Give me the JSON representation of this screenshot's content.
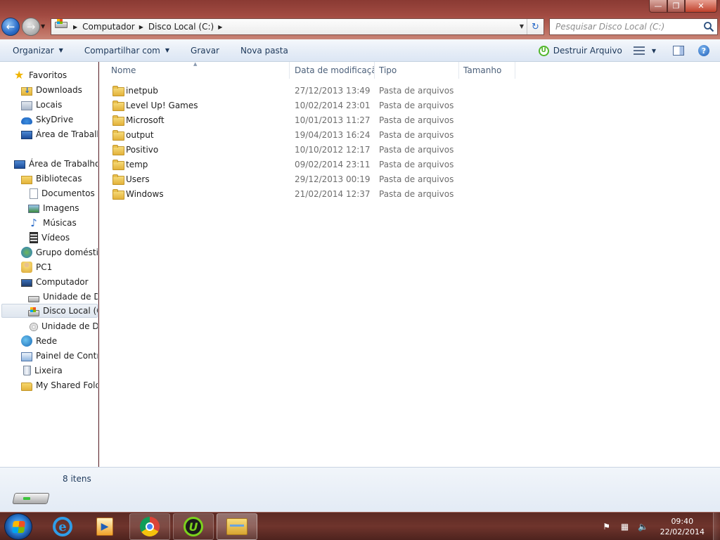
{
  "window": {
    "controls": {
      "minimize": "—",
      "maximize": "❐",
      "close": "✕"
    }
  },
  "address": {
    "crumbs": [
      "Computador",
      "Disco Local (C:)"
    ],
    "search_placeholder": "Pesquisar Disco Local (C:)"
  },
  "toolbar": {
    "organizar": "Organizar",
    "compartilhar": "Compartilhar com",
    "gravar": "Gravar",
    "nova_pasta": "Nova pasta",
    "destruir": "Destruir Arquivo"
  },
  "navpane": {
    "items": [
      {
        "label": "Favoritos",
        "icon": "star-icon"
      },
      {
        "label": "Downloads",
        "icon": "downloads-folder-icon"
      },
      {
        "label": "Locais",
        "icon": "recent-places-icon"
      },
      {
        "label": "SkyDrive",
        "icon": "skydrive-icon"
      },
      {
        "label": "Área de Trabalho",
        "icon": "desktop-icon"
      },
      {
        "label": "Área de Trabalho",
        "icon": "desktop-icon"
      },
      {
        "label": "Bibliotecas",
        "icon": "libraries-icon"
      },
      {
        "label": "Documentos",
        "icon": "documents-icon"
      },
      {
        "label": "Imagens",
        "icon": "pictures-icon"
      },
      {
        "label": "Músicas",
        "icon": "music-icon"
      },
      {
        "label": "Vídeos",
        "icon": "videos-icon"
      },
      {
        "label": "Grupo doméstico",
        "icon": "homegroup-icon"
      },
      {
        "label": "PC1",
        "icon": "user-folder-icon"
      },
      {
        "label": "Computador",
        "icon": "computer-icon"
      },
      {
        "label": "Unidade de Disquete",
        "icon": "drive-icon"
      },
      {
        "label": "Disco Local (C:)",
        "icon": "local-disk-icon"
      },
      {
        "label": "Unidade de DVD",
        "icon": "dvd-drive-icon"
      },
      {
        "label": "Rede",
        "icon": "network-icon"
      },
      {
        "label": "Painel de Controle",
        "icon": "control-panel-icon"
      },
      {
        "label": "Lixeira",
        "icon": "recycle-bin-icon"
      },
      {
        "label": "My Shared Folder",
        "icon": "shared-folder-icon"
      }
    ]
  },
  "columns": [
    "Nome",
    "Data de modificação",
    "Tipo",
    "Tamanho"
  ],
  "files": [
    {
      "name": "inetpub",
      "date": "27/12/2013 13:49",
      "type": "Pasta de arquivos"
    },
    {
      "name": "Level Up! Games",
      "date": "10/02/2014 23:01",
      "type": "Pasta de arquivos"
    },
    {
      "name": "Microsoft",
      "date": "10/01/2013 11:27",
      "type": "Pasta de arquivos"
    },
    {
      "name": "output",
      "date": "19/04/2013 16:24",
      "type": "Pasta de arquivos"
    },
    {
      "name": "Positivo",
      "date": "10/10/2012 12:17",
      "type": "Pasta de arquivos"
    },
    {
      "name": "temp",
      "date": "09/02/2014 23:11",
      "type": "Pasta de arquivos"
    },
    {
      "name": "Users",
      "date": "29/12/2013 00:19",
      "type": "Pasta de arquivos"
    },
    {
      "name": "Windows",
      "date": "21/02/2014 12:37",
      "type": "Pasta de arquivos"
    }
  ],
  "details": {
    "count": "8 itens"
  },
  "taskbar": {
    "time": "09:40",
    "date": "22/02/2014",
    "apps": [
      "internet-explorer-icon",
      "windows-media-player-icon",
      "chrome-icon",
      "iobit-unlocker-icon",
      "windows-explorer-icon"
    ]
  },
  "colors": {
    "title_gradient_top": "#8a3a33",
    "toolbar_text": "#1e395b",
    "taskbar": "#5b2a24"
  }
}
